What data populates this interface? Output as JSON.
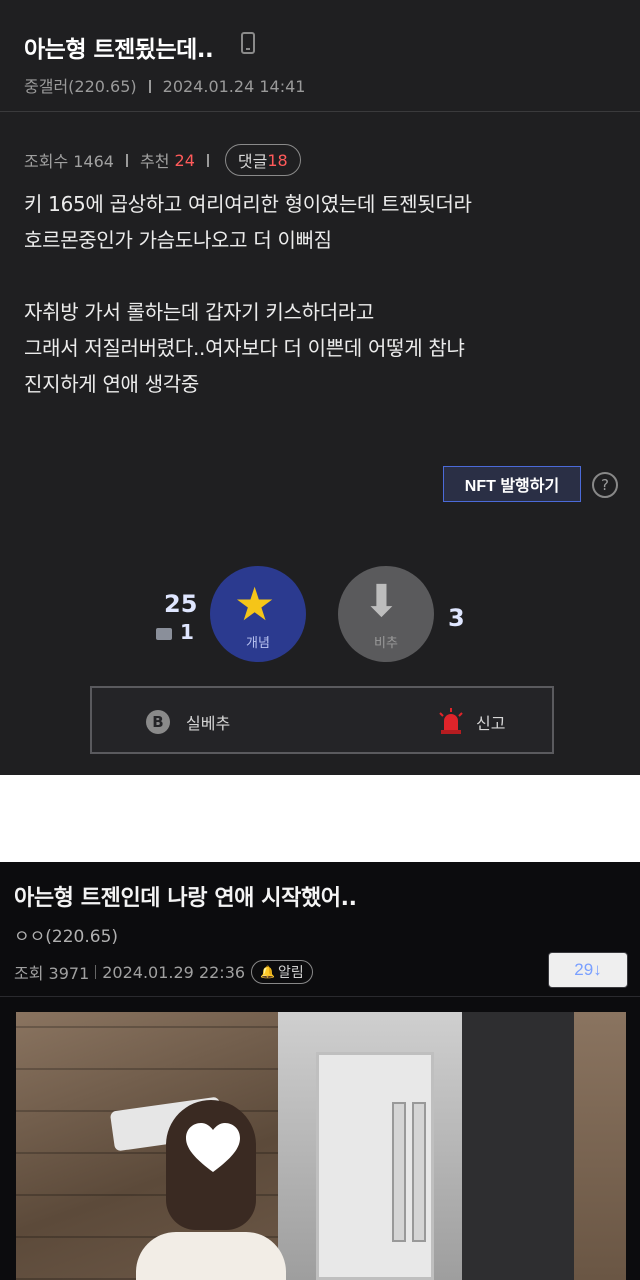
{
  "post1": {
    "title": "아는형 트젠됬는데..",
    "author": "중갤러(220.65)",
    "date": "2024.01.24 14:41",
    "views_label": "조회수 1464",
    "rec_label": "추천",
    "rec_value": "24",
    "comment_label": "댓글",
    "comment_value": "18",
    "body_lines": [
      "키 165에 곱상하고 여리여리한 형이였는데 트젠됫더라",
      "호르몬중인가 가슴도나오고 더 이뻐짐",
      "",
      "자취방 가서 롤하는데 갑자기 키스하더라고",
      "그래서 저질러버렸다..여자보다 더 이쁜데 어떻게 참냐",
      "진지하게 연애 생각중"
    ],
    "nft_label": "NFT 발행하기",
    "help_glyph": "?",
    "upvote_count": "25",
    "fix_count": "1",
    "concept_label": "개념",
    "down_label": "비추",
    "down_count": "3",
    "real_down_label": "실베추",
    "b_glyph": "B",
    "report_label": "신고",
    "colors": {
      "accent": "#2b3a8f",
      "star": "#f5c518",
      "red": "#ff5a5a"
    }
  },
  "post2": {
    "title": "아는형 트젠인데 나랑 연애 시작했어..",
    "author": "ㅇㅇ(220.65)",
    "views": "조회 3971",
    "date": "2024.01.29 22:36",
    "alarm_label": "알림",
    "comment_count": "29↓",
    "colors": {
      "link": "#7aa0ff"
    }
  }
}
